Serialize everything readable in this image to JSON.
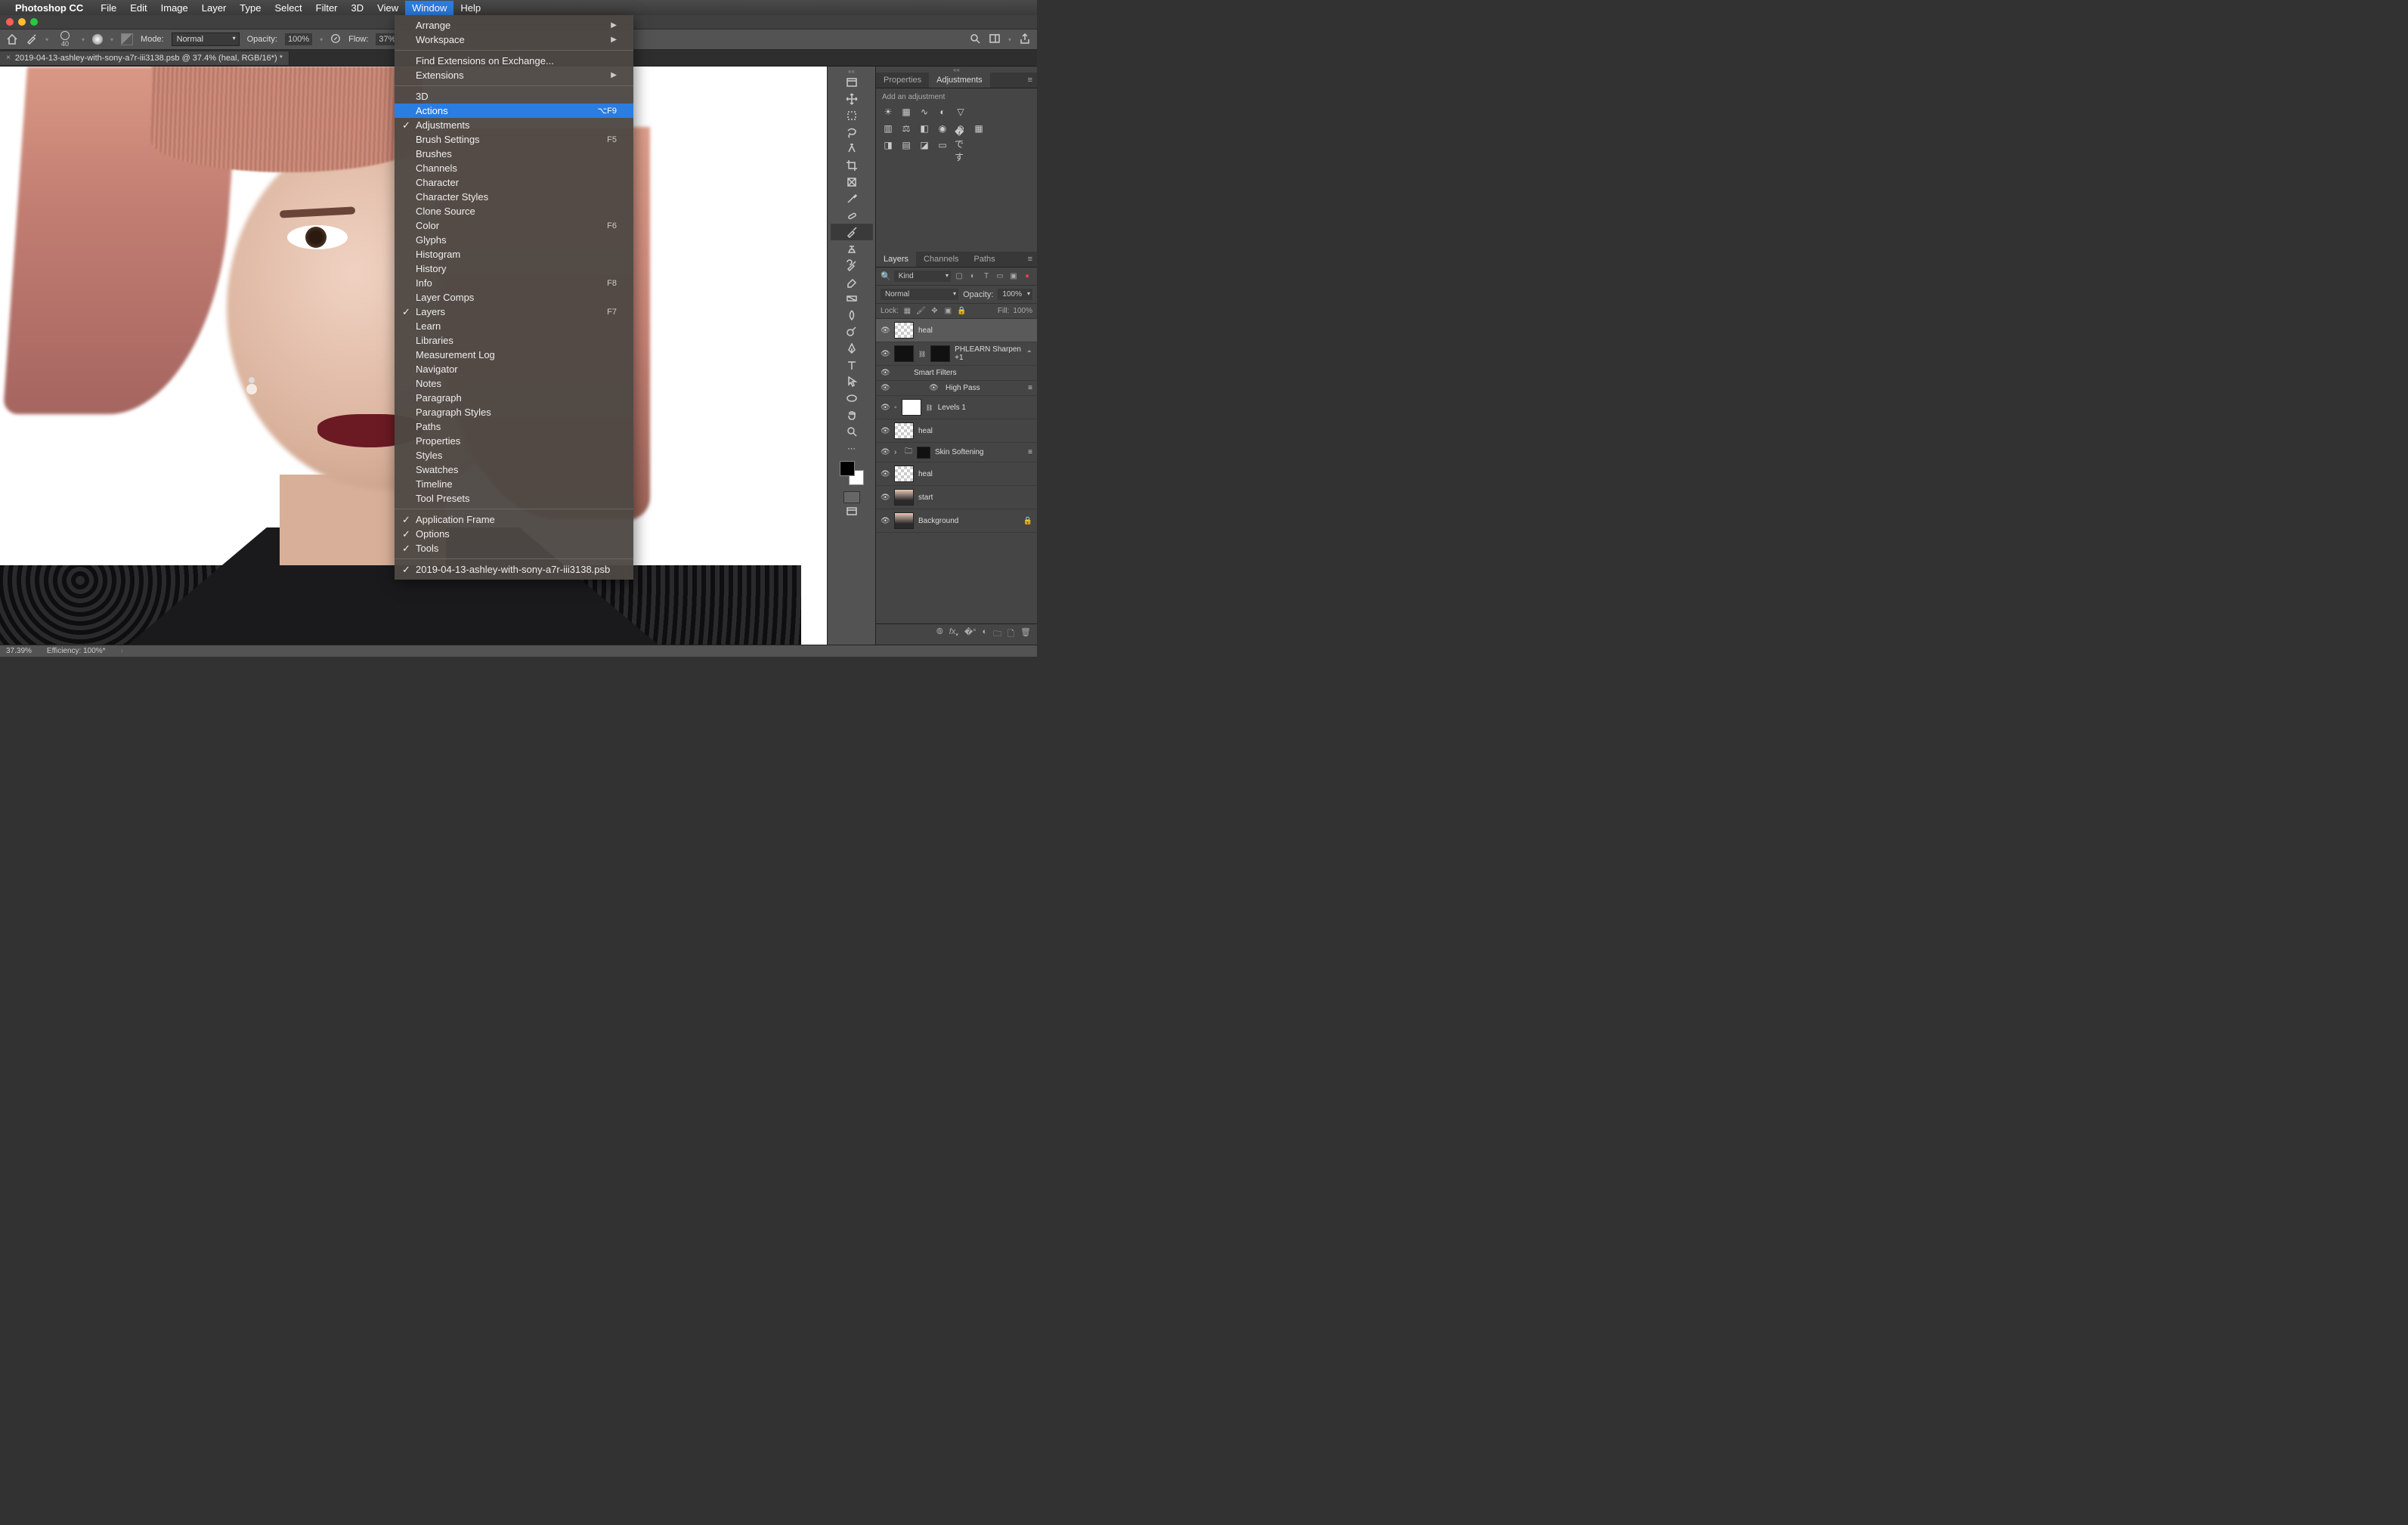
{
  "menubar": {
    "app": "Photoshop CC",
    "items": [
      "File",
      "Edit",
      "Image",
      "Layer",
      "Type",
      "Select",
      "Filter",
      "3D",
      "View",
      "Window",
      "Help"
    ],
    "active": "Window"
  },
  "optionsbar": {
    "brush_size": "40",
    "mode_label": "Mode:",
    "mode_value": "Normal",
    "opacity_label": "Opacity:",
    "opacity_value": "100%",
    "flow_label": "Flow:",
    "flow_value": "37%"
  },
  "document": {
    "tab": "2019-04-13-ashley-with-sony-a7r-iii3138.psb @ 37.4% (heal, RGB/16*) *"
  },
  "window_menu": {
    "groups": [
      [
        {
          "label": "Arrange",
          "submenu": true
        },
        {
          "label": "Workspace",
          "submenu": true
        }
      ],
      [
        {
          "label": "Find Extensions on Exchange..."
        },
        {
          "label": "Extensions",
          "submenu": true
        }
      ],
      [
        {
          "label": "3D"
        },
        {
          "label": "Actions",
          "shortcut": "⌥F9",
          "highlight": true
        },
        {
          "label": "Adjustments",
          "checked": true
        },
        {
          "label": "Brush Settings",
          "shortcut": "F5"
        },
        {
          "label": "Brushes"
        },
        {
          "label": "Channels"
        },
        {
          "label": "Character"
        },
        {
          "label": "Character Styles"
        },
        {
          "label": "Clone Source"
        },
        {
          "label": "Color",
          "shortcut": "F6"
        },
        {
          "label": "Glyphs"
        },
        {
          "label": "Histogram"
        },
        {
          "label": "History"
        },
        {
          "label": "Info",
          "shortcut": "F8"
        },
        {
          "label": "Layer Comps"
        },
        {
          "label": "Layers",
          "shortcut": "F7",
          "checked": true
        },
        {
          "label": "Learn"
        },
        {
          "label": "Libraries"
        },
        {
          "label": "Measurement Log"
        },
        {
          "label": "Navigator"
        },
        {
          "label": "Notes"
        },
        {
          "label": "Paragraph"
        },
        {
          "label": "Paragraph Styles"
        },
        {
          "label": "Paths"
        },
        {
          "label": "Properties"
        },
        {
          "label": "Styles"
        },
        {
          "label": "Swatches"
        },
        {
          "label": "Timeline"
        },
        {
          "label": "Tool Presets"
        }
      ],
      [
        {
          "label": "Application Frame",
          "checked": true
        },
        {
          "label": "Options",
          "checked": true
        },
        {
          "label": "Tools",
          "checked": true
        }
      ],
      [
        {
          "label": "2019-04-13-ashley-with-sony-a7r-iii3138.psb",
          "checked": true
        }
      ]
    ]
  },
  "properties_panel": {
    "tabs": [
      "Properties",
      "Adjustments"
    ],
    "active": "Adjustments",
    "hint": "Add an adjustment"
  },
  "layers_panel": {
    "tabs": [
      "Layers",
      "Channels",
      "Paths"
    ],
    "active": "Layers",
    "kind": "Kind",
    "blend": "Normal",
    "opacity_label": "Opacity:",
    "opacity_value": "100%",
    "lock_label": "Lock:",
    "fill_label": "Fill:",
    "fill_value": "100%",
    "layers": [
      {
        "name": "heal",
        "thumb": "checker",
        "selected": true
      },
      {
        "name": "PHLEARN Sharpen +1",
        "thumb": "black",
        "smart": true,
        "expand": true
      },
      {
        "name": "Smart Filters",
        "indent": 1,
        "thumbless": true
      },
      {
        "name": "High Pass",
        "indent": 2,
        "thumbless": true,
        "filter_toggle": true
      },
      {
        "name": "Levels 1",
        "thumb": "white",
        "adj": true
      },
      {
        "name": "heal",
        "thumb": "checker"
      },
      {
        "name": "Skin Softening",
        "thumb": "black",
        "group": true,
        "filter_toggle": true
      },
      {
        "name": "heal",
        "thumb": "checker"
      },
      {
        "name": "start",
        "thumb": "face"
      },
      {
        "name": "Background",
        "thumb": "face",
        "locked": true
      }
    ]
  },
  "status": {
    "zoom": "37.39%",
    "efficiency": "Efficiency: 100%*"
  }
}
